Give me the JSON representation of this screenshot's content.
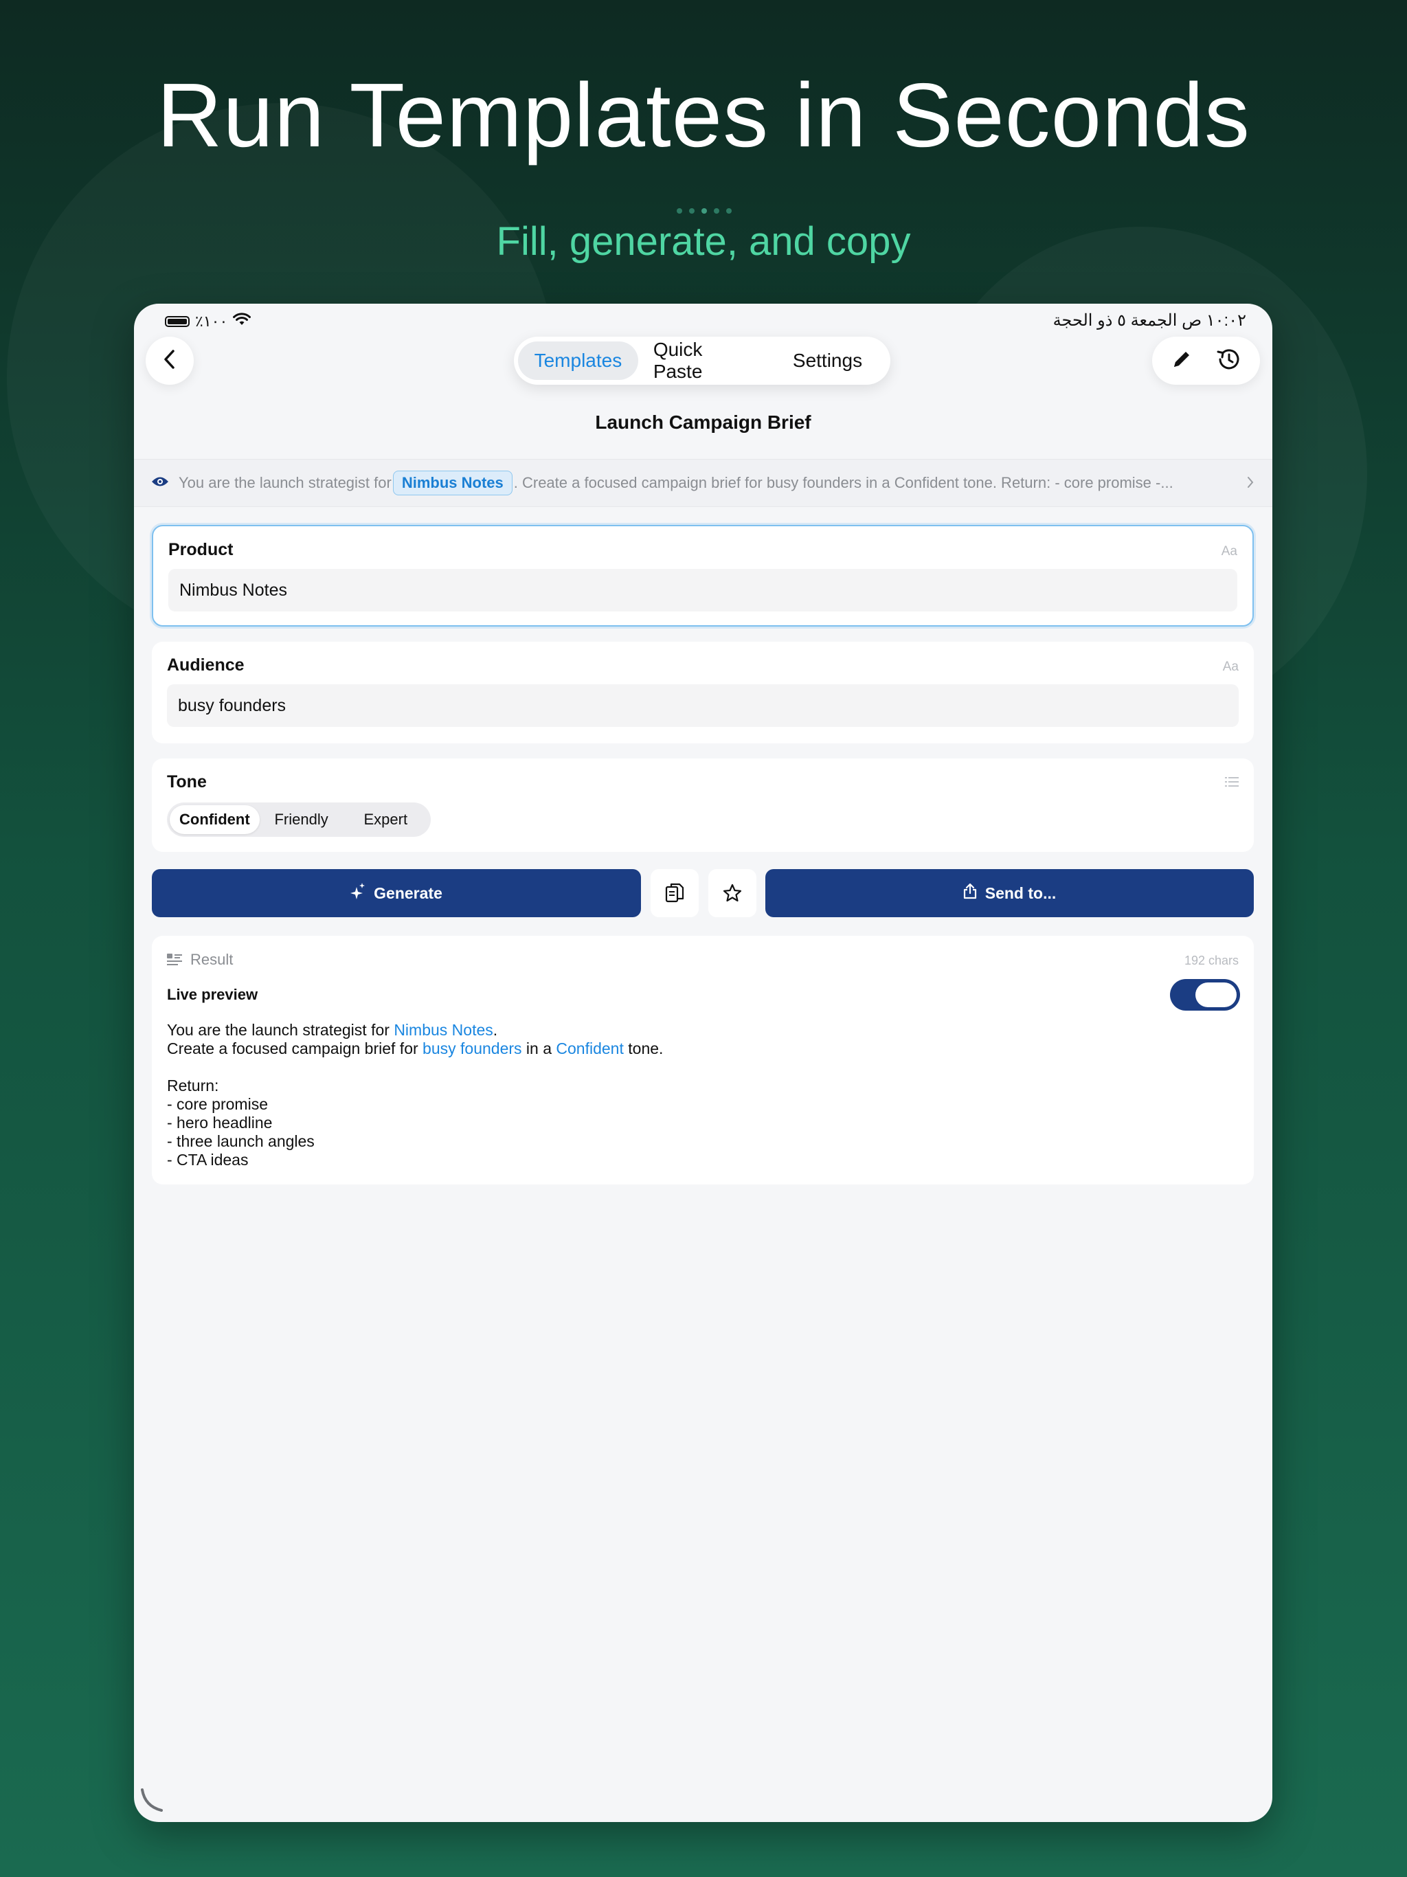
{
  "marketing": {
    "headline": "Run Templates in Seconds",
    "subheadline": "Fill, generate, and copy"
  },
  "status_bar": {
    "battery": "٪١٠٠",
    "datetime": "١٠:٠٢ ص   الجمعة ٥ ذو الحجة"
  },
  "nav": {
    "tabs": [
      "Templates",
      "Quick Paste",
      "Settings"
    ],
    "active_tab": "Templates"
  },
  "page": {
    "title": "Launch Campaign Brief"
  },
  "prompt_preview": {
    "before": "You are the launch strategist for",
    "chip": "Nimbus Notes",
    "after": ". Create a focused campaign brief for busy founders in a Confident tone. Return: - core promise -..."
  },
  "fields": {
    "product": {
      "label": "Product",
      "hint": "Aa",
      "value": "Nimbus Notes"
    },
    "audience": {
      "label": "Audience",
      "hint": "Aa",
      "value": "busy founders"
    },
    "tone": {
      "label": "Tone",
      "options": [
        "Confident",
        "Friendly",
        "Expert"
      ],
      "selected": "Confident"
    }
  },
  "actions": {
    "generate_label": "Generate",
    "send_label": "Send to..."
  },
  "result": {
    "title": "Result",
    "char_count": "192 chars",
    "live_preview_label": "Live preview",
    "live_preview_on": true,
    "line1_pre": "You are the launch strategist for ",
    "line1_hl": "Nimbus Notes",
    "line1_post": ".",
    "line2_pre": "Create a focused campaign brief for ",
    "line2_hl1": "busy founders",
    "line2_mid": " in a ",
    "line2_hl2": "Confident",
    "line2_post": " tone.",
    "return_label": "Return:",
    "items": [
      "- core promise",
      "- hero headline",
      "- three launch angles",
      "- CTA ideas"
    ]
  },
  "colors": {
    "accent_blue": "#1a86e0",
    "primary_button": "#1b3d83",
    "subheadline_green": "#4fd6a3"
  }
}
